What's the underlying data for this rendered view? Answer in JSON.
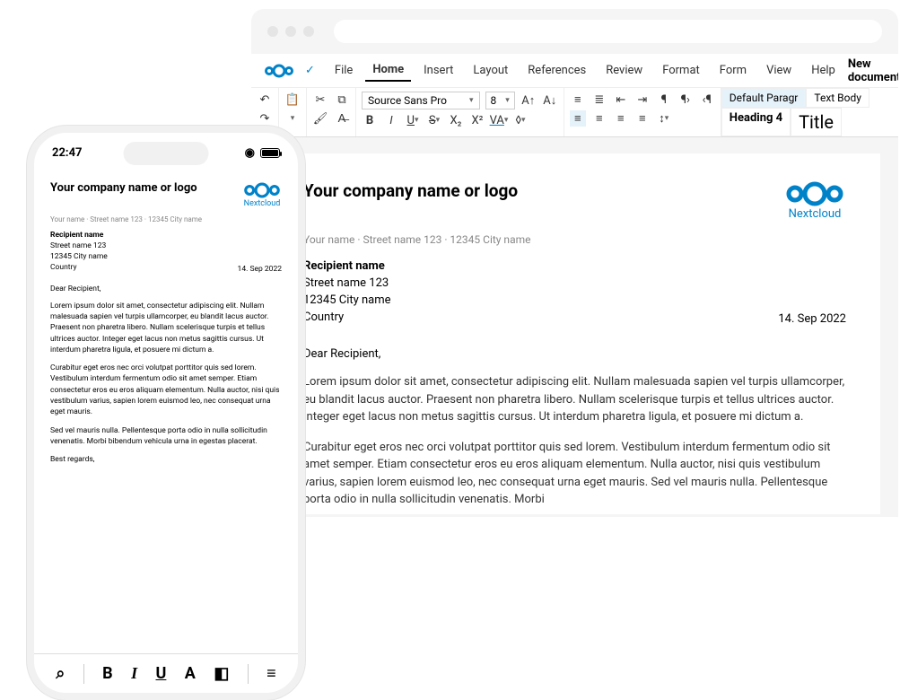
{
  "colors": {
    "brand": "#0082c9"
  },
  "desktop": {
    "menus": [
      "File",
      "Home",
      "Insert",
      "Layout",
      "References",
      "Review",
      "Format",
      "Form",
      "View",
      "Help"
    ],
    "active_menu": "Home",
    "docname": "New document.odt",
    "font": "Source Sans Pro",
    "font_size": "8",
    "styles": {
      "default": "Default Paragr",
      "textbody": "Text Body",
      "h4": "Heading 4",
      "title": "Title"
    }
  },
  "mobile": {
    "time": "22:47"
  },
  "document": {
    "company": "Your company name or logo",
    "brand": "Nextcloud",
    "address_line": "Your name  ·  Street name 123  ·  12345 City name",
    "recipient": {
      "name": "Recipient name",
      "street": "Street name 123",
      "city": "12345 City name",
      "country": "Country"
    },
    "date": "14. Sep 2022",
    "salutation": "Dear Recipient,",
    "p1": "Lorem ipsum dolor sit amet, consectetur adipiscing elit. Nullam malesuada sapien vel turpis ullamcorper, eu blandit lacus auctor. Praesent non pharetra libero. Nullam scelerisque turpis et tellus ultrices auctor. Integer eget lacus non metus sagittis cursus. Ut interdum pharetra ligula, et posuere mi dictum a.",
    "p2": "Curabitur eget eros nec orci volutpat porttitor quis sed lorem. Vestibulum interdum fermentum odio sit amet semper. Etiam consectetur eros eu eros aliquam elementum. Nulla auctor, nisi quis vestibulum varius, sapien lorem euismod leo, nec consequat urna eget mauris.",
    "p3": "Sed vel mauris nulla. Pellentesque porta odio in nulla sollicitudin venenatis. Morbi bibendum vehicula urna in egestas placerat.",
    "signoff": "Best regards,",
    "p2_ext": "Curabitur eget eros nec orci volutpat porttitor quis sed lorem. Vestibulum interdum fermentum odio sit amet semper. Etiam consectetur eros eu eros aliquam elementum. Nulla auctor, nisi quis vestibulum varius, sapien lorem euismod leo, nec consequat urna eget mauris. Sed vel mauris nulla. Pellentesque porta odio in nulla sollicitudin venenatis. Morbi"
  }
}
